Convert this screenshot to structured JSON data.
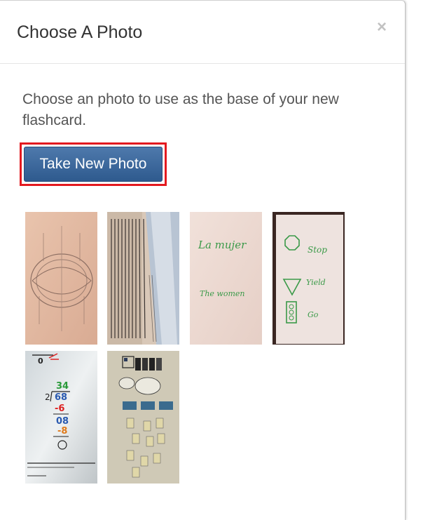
{
  "modal": {
    "title": "Choose A Photo",
    "close_label": "×",
    "description": "Choose an photo to use as the base of your new flashcard.",
    "take_photo_label": "Take New Photo"
  },
  "thumbnails": [
    {
      "subject": "textbook-diagram-photo"
    },
    {
      "subject": "open-book-page-photo"
    },
    {
      "subject": "whiteboard-la-mujer-photo",
      "text_lines": [
        "La mujer",
        "The women"
      ]
    },
    {
      "subject": "whiteboard-traffic-signs-photo",
      "text_lines": [
        "Stop",
        "Yield",
        "Go"
      ]
    },
    {
      "subject": "long-division-worksheet-photo",
      "text_lines": [
        "34",
        "2",
        "68",
        "-6",
        "08",
        "-8",
        "0"
      ]
    },
    {
      "subject": "wall-chart-diagram-photo"
    }
  ],
  "colors": {
    "button_top": "#4e79ac",
    "button_bottom": "#2e5a8e",
    "highlight_border": "#e3191f"
  }
}
